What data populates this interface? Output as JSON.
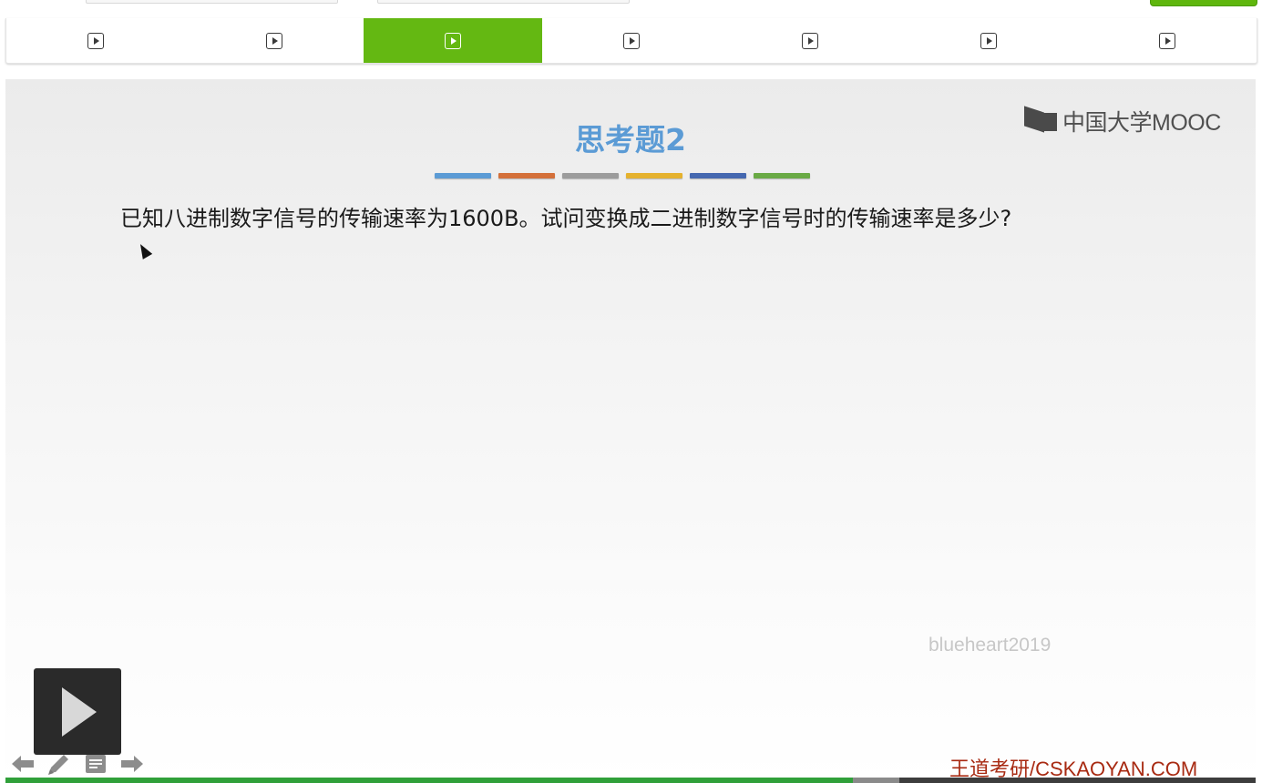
{
  "unit_tabs": {
    "count": 7,
    "active_index": 2,
    "accent": "#64b812",
    "icon": "play-square-icon"
  },
  "slide": {
    "title": "思考题2",
    "color_bars": [
      "#5b9bd5",
      "#d4703a",
      "#9c9c9c",
      "#e5b22e",
      "#4568b0",
      "#6aaa45"
    ],
    "logo_text": "中国大学MOOC",
    "question": "已知八进制数字信号的传输速率为1600B。试问变换成二进制数字信号时的传输速率是多少?",
    "watermark": "blueheart2019",
    "footer_brand": "王道考研/CSKAOYAN.COM"
  },
  "player": {
    "play_icon": "play-icon",
    "tools": [
      "arrow-left-icon",
      "pen-icon",
      "notes-icon",
      "arrow-right-icon"
    ],
    "progress_played": 0.678,
    "progress_buffered": 0.715
  }
}
